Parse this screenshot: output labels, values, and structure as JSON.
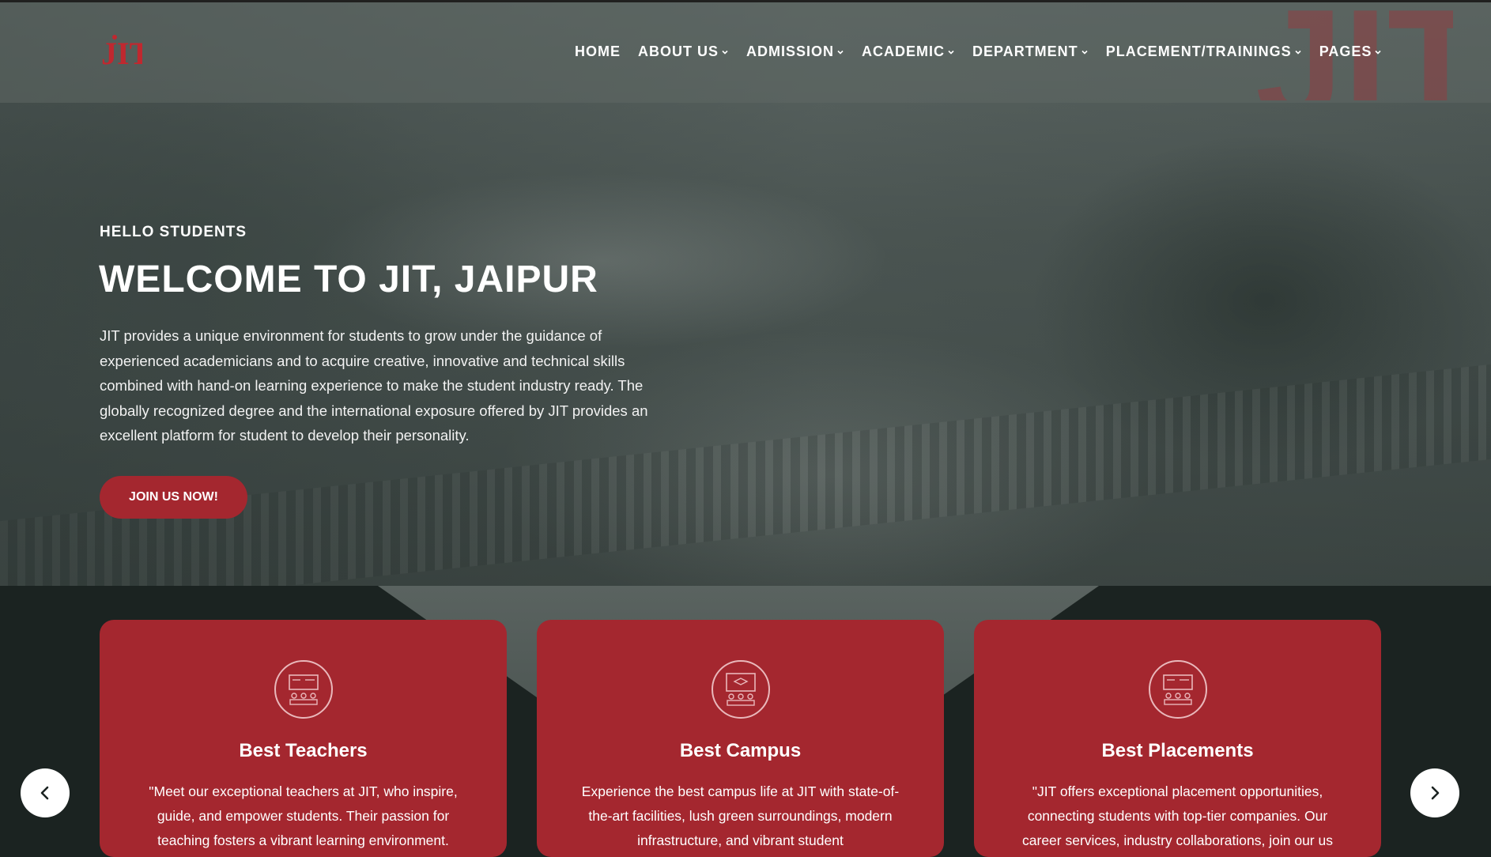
{
  "header": {
    "nav": [
      {
        "label": "HOME",
        "has_dropdown": false
      },
      {
        "label": "ABOUT US",
        "has_dropdown": true
      },
      {
        "label": "ADMISSION",
        "has_dropdown": true
      },
      {
        "label": "ACADEMIC",
        "has_dropdown": true
      },
      {
        "label": "DEPARTMENT",
        "has_dropdown": true
      },
      {
        "label": "PLACEMENT/TRAININGS",
        "has_dropdown": true
      },
      {
        "label": "PAGES",
        "has_dropdown": true
      }
    ],
    "logo_text": "JIT",
    "watermark_text": "JIT"
  },
  "hero": {
    "kicker": "HELLO STUDENTS",
    "title": "WELCOME TO JIT, JAIPUR",
    "description": "JIT provides a unique environment for students to grow under the guidance of experienced academicians and to acquire creative, innovative and technical skills combined with hand-on learning experience to make the student industry ready. The globally recognized degree and the international exposure offered by JIT provides an excellent platform for student to develop their personality.",
    "cta_label": "JOIN US NOW!"
  },
  "cards": [
    {
      "title": "Best Teachers",
      "icon": "classroom-icon",
      "text": "\"Meet our exceptional teachers at JIT, who inspire, guide, and empower students. Their passion for teaching fosters a vibrant learning environment."
    },
    {
      "title": "Best Campus",
      "icon": "campus-icon",
      "text": "Experience the best campus life at JIT with state-of-the-art facilities, lush green surroundings, modern infrastructure, and vibrant student"
    },
    {
      "title": "Best Placements",
      "icon": "placement-icon",
      "text": "\"JIT offers exceptional placement opportunities, connecting students with top-tier companies. Our career services, industry collaborations, join our us"
    }
  ],
  "colors": {
    "brand_red": "#a4272f",
    "dark_bg": "#1b2321"
  },
  "carousel": {
    "prev_icon": "chevron-left-icon",
    "next_icon": "chevron-right-icon"
  }
}
